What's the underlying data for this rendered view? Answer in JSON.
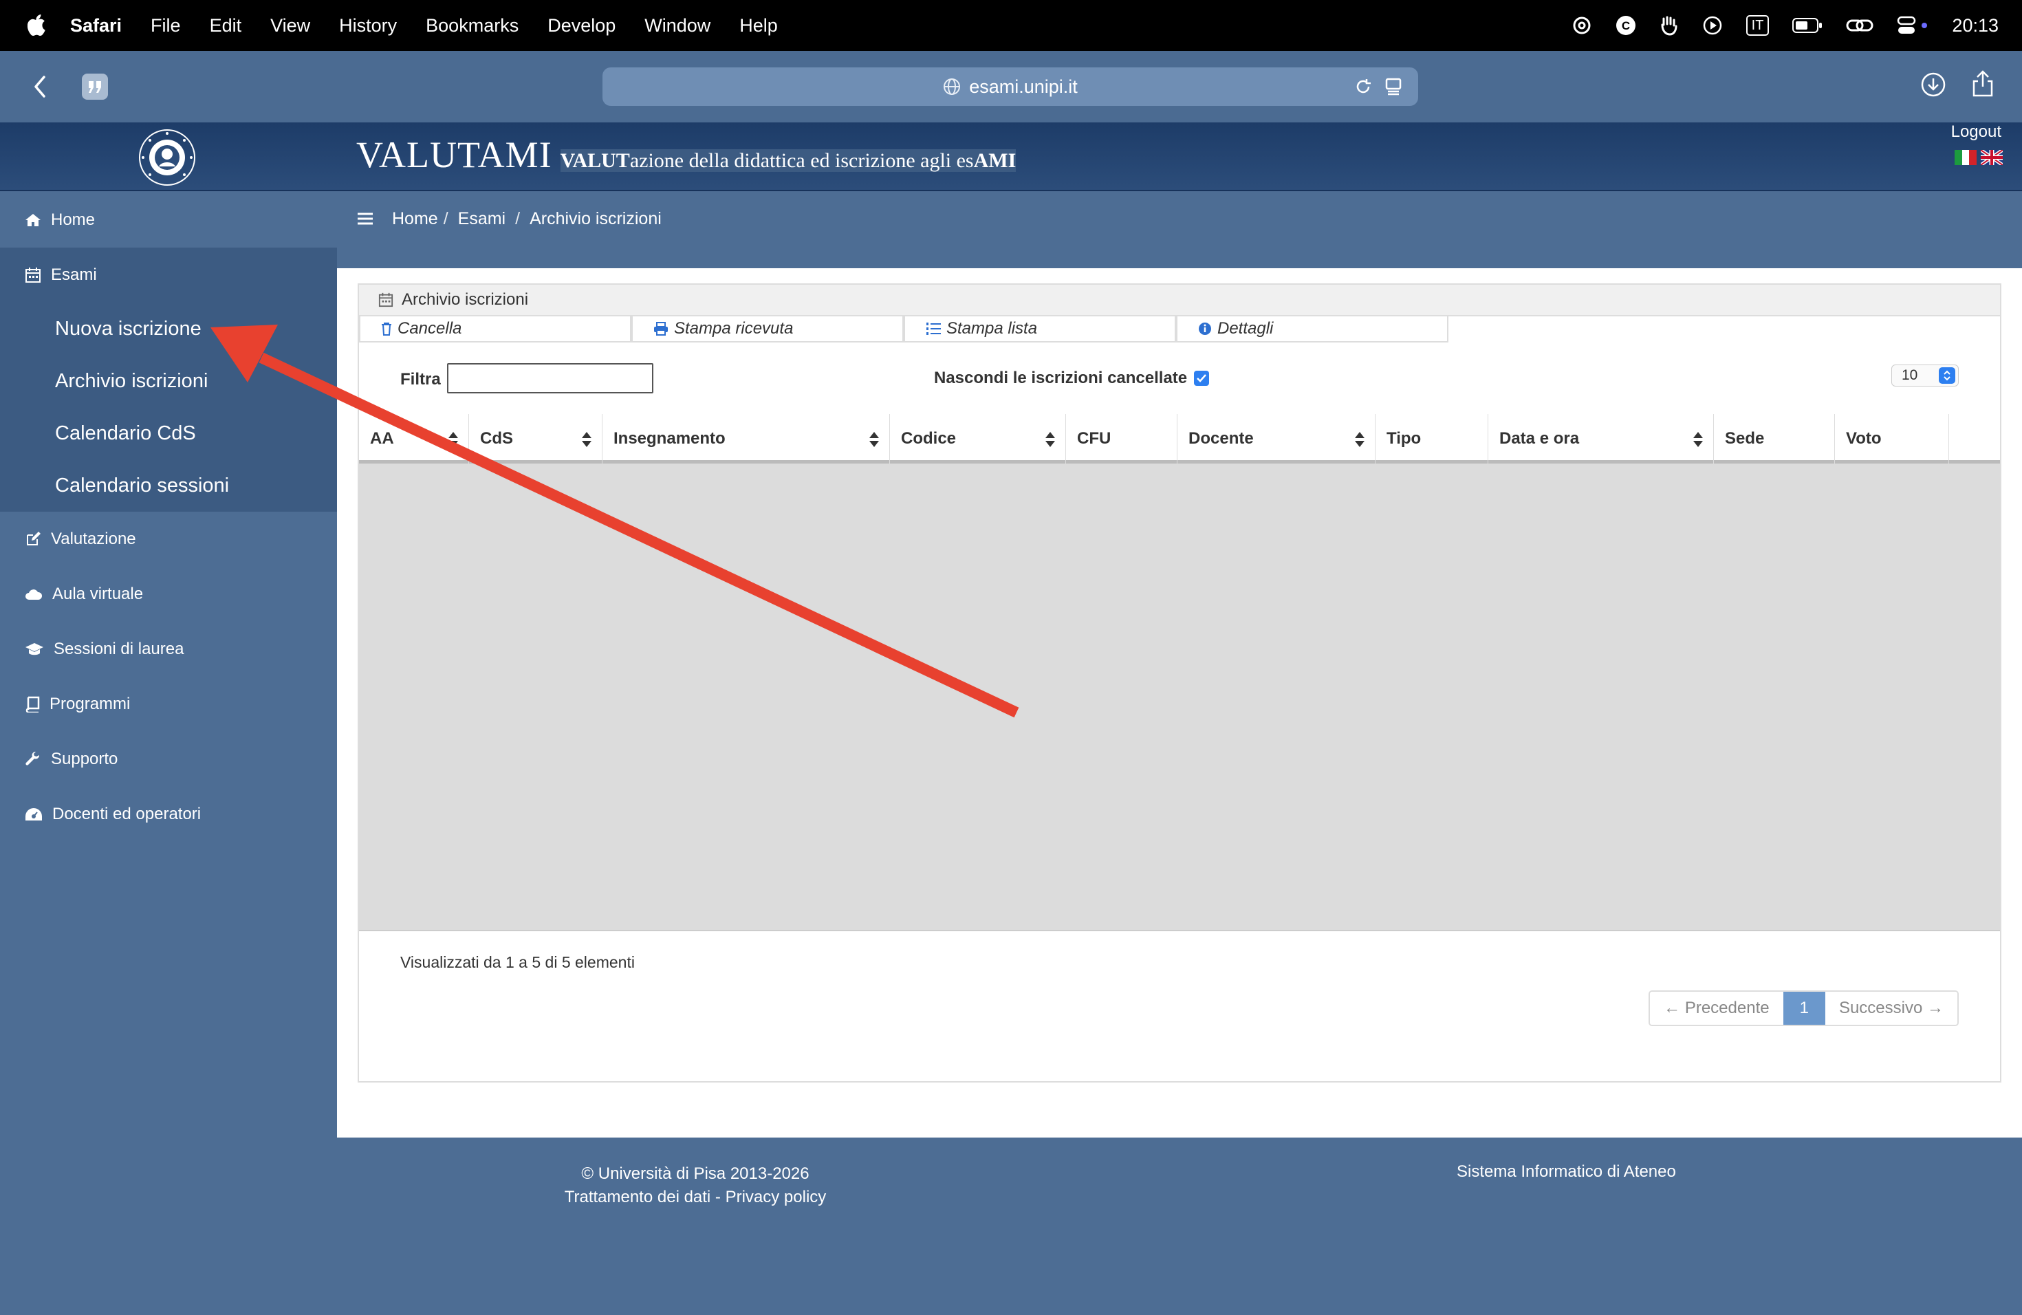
{
  "menubar": {
    "app": "Safari",
    "items": [
      "File",
      "Edit",
      "View",
      "History",
      "Bookmarks",
      "Develop",
      "Window",
      "Help"
    ],
    "input_source": "IT",
    "time": "20:13"
  },
  "browser": {
    "url": "esami.unipi.it"
  },
  "site": {
    "brand_big": "VALUTAMI",
    "brand_sub_bold1": "VALUT",
    "brand_sub_text1": "azione della didattica ed iscrizione agli es",
    "brand_sub_bold2": "AMI",
    "logout": "Logout"
  },
  "sidebar": {
    "items": [
      {
        "label": "Home",
        "icon": "home-icon"
      },
      {
        "label": "Esami",
        "icon": "calendar-icon"
      },
      {
        "label": "Valutazione",
        "icon": "edit-icon"
      },
      {
        "label": "Aula virtuale",
        "icon": "cloud-icon"
      },
      {
        "label": "Sessioni di laurea",
        "icon": "graduation-cap-icon"
      },
      {
        "label": "Programmi",
        "icon": "book-icon"
      },
      {
        "label": "Supporto",
        "icon": "wrench-icon"
      },
      {
        "label": "Docenti ed operatori",
        "icon": "dashboard-icon"
      }
    ],
    "esami_sub": [
      "Nuova iscrizione",
      "Archivio iscrizioni",
      "Calendario CdS",
      "Calendario sessioni"
    ]
  },
  "breadcrumb": [
    "Home",
    "Esami",
    "Archivio iscrizioni"
  ],
  "panel": {
    "title": "Archivio iscrizioni",
    "buttons": [
      "Cancella",
      "Stampa ricevuta",
      "Stampa lista",
      "Dettagli"
    ],
    "filter_label": "Filtra",
    "filter_value": "",
    "hide_cancelled_label": "Nascondi le iscrizioni cancellate",
    "hide_cancelled_checked": true,
    "page_size": "10"
  },
  "table": {
    "columns": [
      "AA",
      "CdS",
      "Insegnamento",
      "Codice",
      "CFU",
      "Docente",
      "Tipo",
      "Data e ora",
      "Sede",
      "Voto"
    ],
    "rows": []
  },
  "pagination": {
    "info": "Visualizzati da 1 a 5 di 5 elementi",
    "prev": "← Precedente",
    "current": "1",
    "next": "Successivo →"
  },
  "footer": {
    "copyright": "© Università di Pisa 2013-2026",
    "privacy": "Trattamento dei dati - Privacy policy",
    "sia": "Sistema Informatico di Ateneo"
  },
  "colors": {
    "annotation_arrow": "#e8412f",
    "sidebar": "#4d6d94",
    "header": "#1d3c68"
  }
}
